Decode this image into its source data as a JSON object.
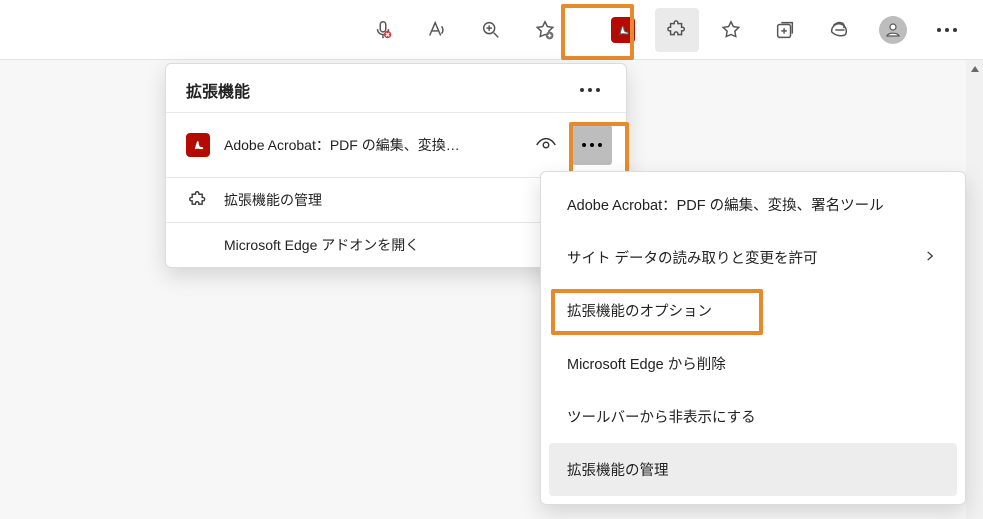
{
  "toolbar": {
    "icons": {
      "voice": "voice-icon",
      "readaloud": "read-aloud-icon",
      "zoom": "zoom-icon",
      "favoriteadd": "favorite-add-icon",
      "acrobat": "acrobat-extension-icon",
      "extensions": "extensions-icon",
      "favorites": "favorites-icon",
      "collections": "collections-icon",
      "ie": "ie-mode-icon",
      "profile": "profile-avatar",
      "more": "more-icon"
    }
  },
  "popup": {
    "title": "拡張機能",
    "item_label": "Adobe Acrobat：PDF の編集、変換…",
    "manage_label": "拡張機能の管理",
    "addons_label": "Microsoft Edge アドオンを開く"
  },
  "ctx": {
    "title": "Adobe Acrobat：PDF の編集、変換、署名ツール",
    "site_data": "サイト データの読み取りと変更を許可",
    "options": "拡張機能のオプション",
    "remove": "Microsoft Edge から削除",
    "hide": "ツールバーから非表示にする",
    "manage": "拡張機能の管理"
  },
  "colors": {
    "highlight": "#e68a2e",
    "acrobat": "#b30b00"
  }
}
